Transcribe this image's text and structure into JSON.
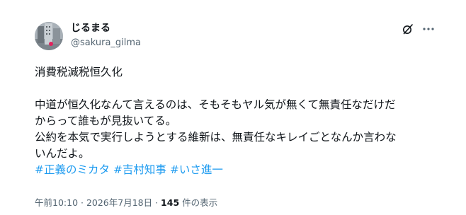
{
  "tweet": {
    "author": {
      "display_name": "じるまる",
      "handle": "@sakura_gilma"
    },
    "icons": {
      "grok": "grok-icon",
      "more": "more-icon"
    },
    "body": {
      "line1": "消費税減税恒久化",
      "para2_line1": "中道が恒久化なんて言えるのは、そもそもヤル気が無くて無責任なだけだ",
      "para2_line2": "からって誰もが見抜いてる。",
      "para3_line1": "公約を本気で実行しようとする維新は、無責任なキレイごとなんか言わな",
      "para3_line2": "いんだよ。"
    },
    "hashtags": [
      "#正義のミカタ",
      "#吉村知事",
      "#いさ進一"
    ],
    "meta": {
      "timestamp": "午前10:10 · 2026年7月18日",
      "separator": " · ",
      "views_count": "145",
      "views_label": " 件の表示"
    },
    "colors": {
      "link": "#1d9bf0",
      "text": "#0f1419",
      "secondary": "#536471"
    }
  }
}
